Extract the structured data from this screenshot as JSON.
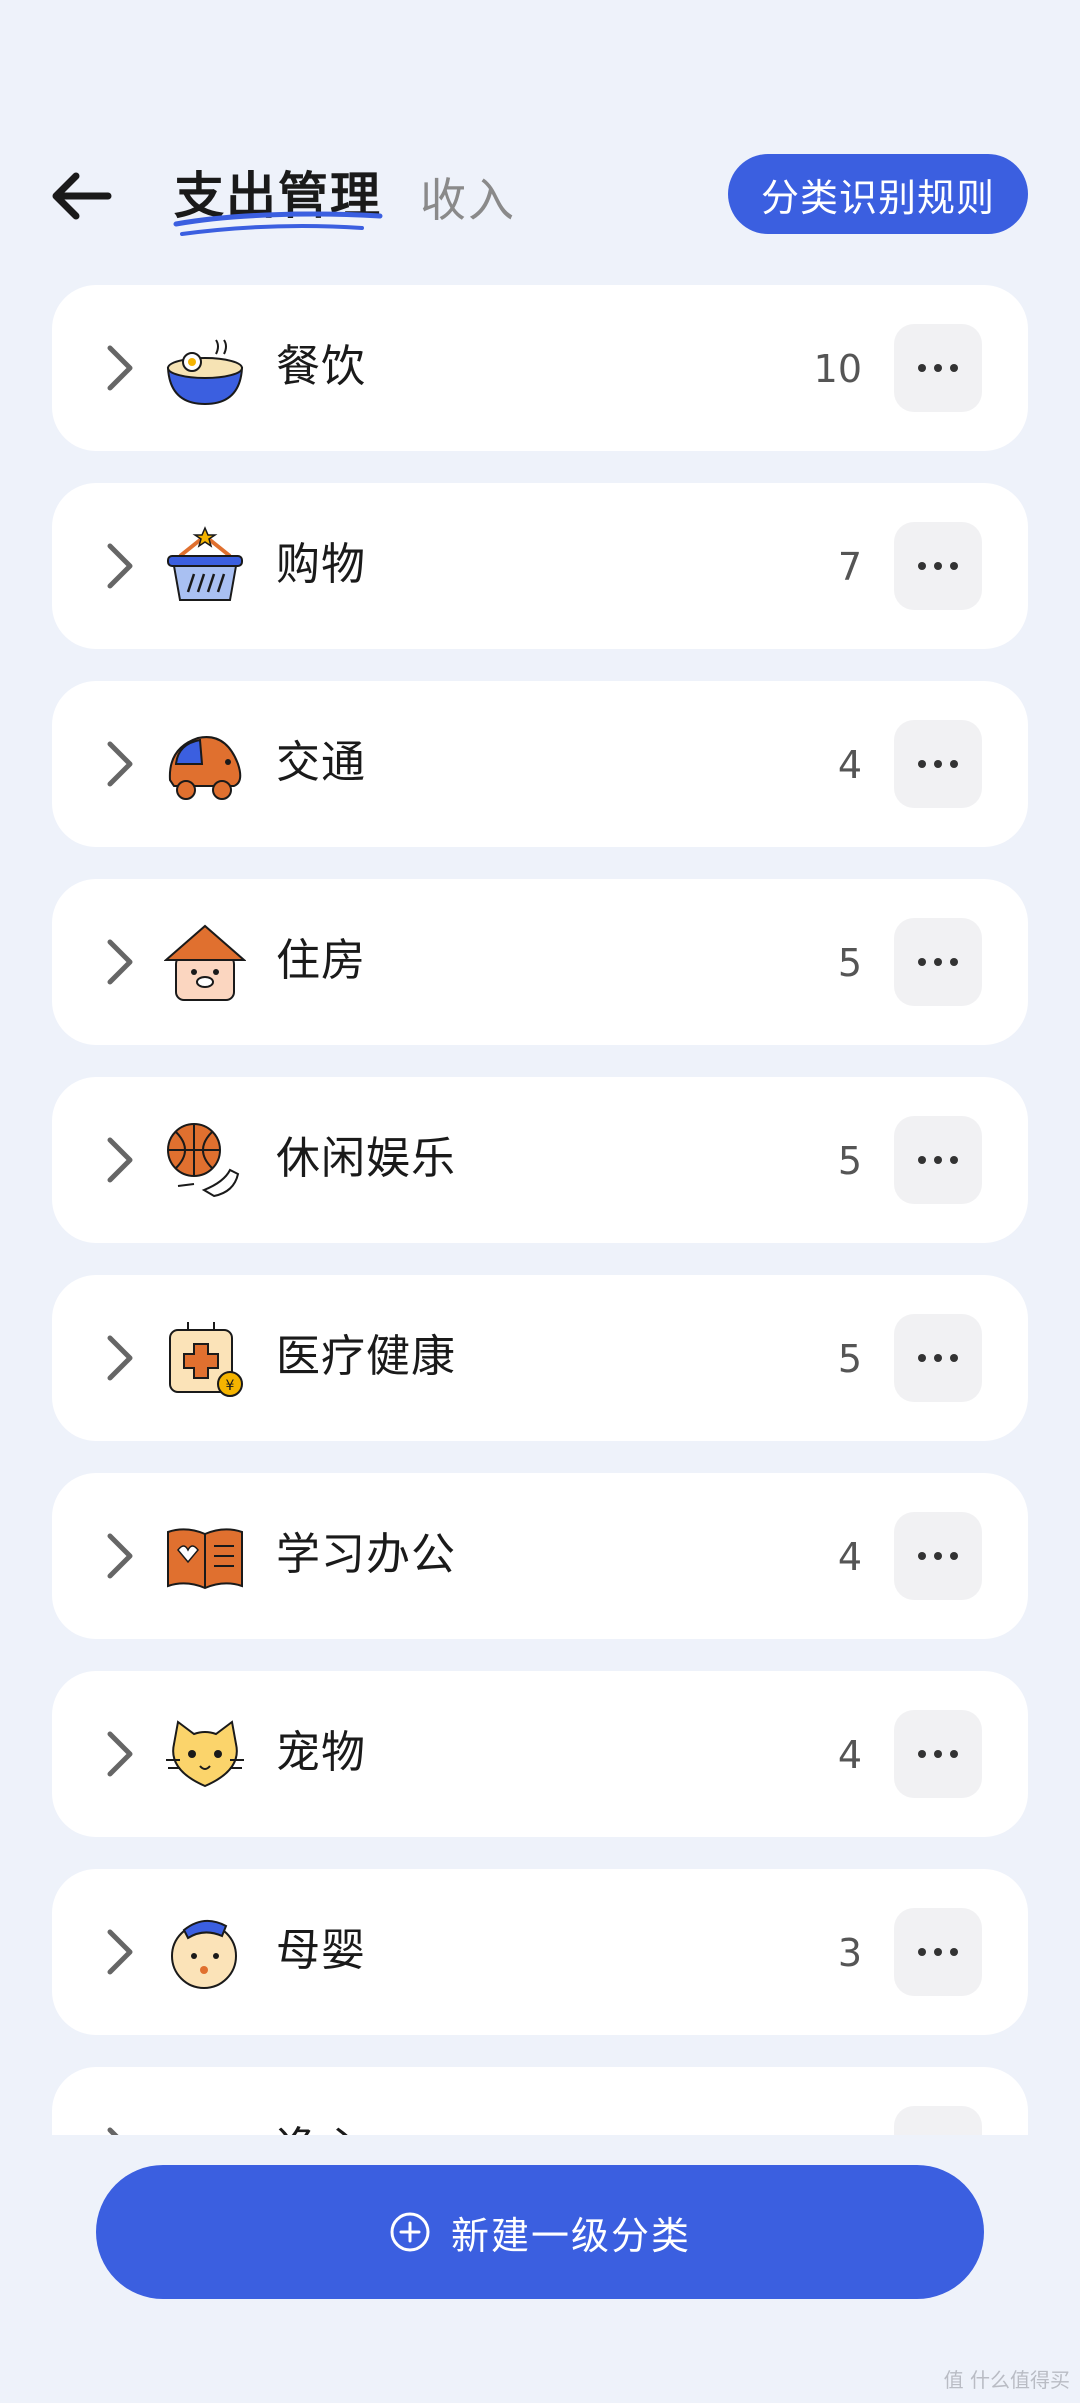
{
  "header": {
    "tab_expense": "支出管理",
    "tab_income": "收入",
    "rules_button": "分类识别规则"
  },
  "categories": [
    {
      "name": "餐饮",
      "count": "10",
      "icon": "noodle-bowl-icon"
    },
    {
      "name": "购物",
      "count": "7",
      "icon": "shopping-basket-icon"
    },
    {
      "name": "交通",
      "count": "4",
      "icon": "car-icon"
    },
    {
      "name": "住房",
      "count": "5",
      "icon": "house-icon"
    },
    {
      "name": "休闲娱乐",
      "count": "5",
      "icon": "basketball-icon"
    },
    {
      "name": "医疗健康",
      "count": "5",
      "icon": "medical-kit-icon"
    },
    {
      "name": "学习办公",
      "count": "4",
      "icon": "book-icon"
    },
    {
      "name": "宠物",
      "count": "4",
      "icon": "cat-icon"
    },
    {
      "name": "母婴",
      "count": "3",
      "icon": "baby-icon"
    },
    {
      "name": "逸心",
      "count": "",
      "icon": "partial-icon"
    }
  ],
  "footer": {
    "new_button": "新建一级分类",
    "watermark": "值 什么值得买"
  },
  "colors": {
    "accent": "#3b5fe0",
    "background": "#eef2fa",
    "card": "#ffffff"
  }
}
